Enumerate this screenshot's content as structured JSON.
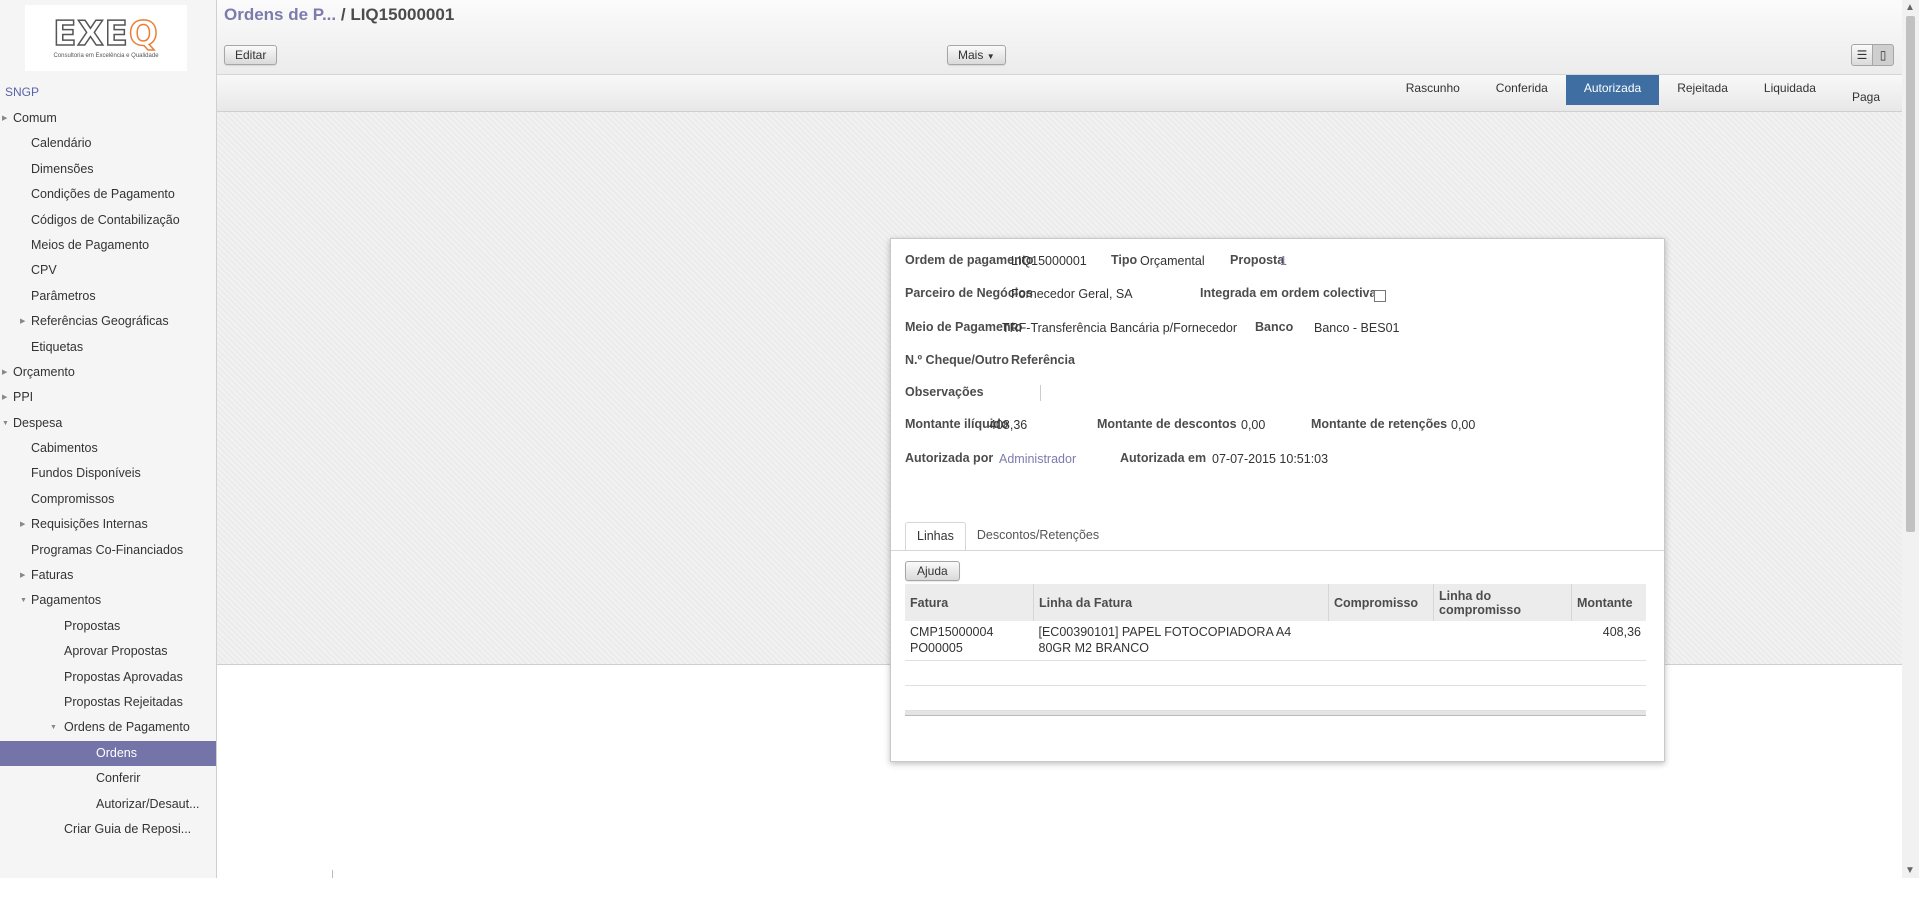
{
  "sidebar": {
    "logo_text": "EXEQ",
    "logo_tagline": "Consultoria em Excelência e Qualidade",
    "app_title": "SNGP",
    "items": [
      {
        "label": "Comum",
        "level": 1,
        "caret": "right"
      },
      {
        "label": "Calendário",
        "level": 2
      },
      {
        "label": "Dimensões",
        "level": 2
      },
      {
        "label": "Condições de Pagamento",
        "level": 2
      },
      {
        "label": "Códigos de Contabilização",
        "level": 2
      },
      {
        "label": "Meios de Pagamento",
        "level": 2
      },
      {
        "label": "CPV",
        "level": 2
      },
      {
        "label": "Parâmetros",
        "level": 2
      },
      {
        "label": "Referências Geográficas",
        "level": 2,
        "caret": "right"
      },
      {
        "label": "Etiquetas",
        "level": 2
      },
      {
        "label": "Orçamento",
        "level": 1,
        "caret": "right"
      },
      {
        "label": "PPI",
        "level": 1,
        "caret": "right"
      },
      {
        "label": "Despesa",
        "level": 1,
        "caret": "down"
      },
      {
        "label": "Cabimentos",
        "level": 2
      },
      {
        "label": "Fundos Disponíveis",
        "level": 2
      },
      {
        "label": "Compromissos",
        "level": 2
      },
      {
        "label": "Requisições Internas",
        "level": 2,
        "caret": "right"
      },
      {
        "label": "Programas Co-Financiados",
        "level": 2
      },
      {
        "label": "Faturas",
        "level": 2,
        "caret": "right"
      },
      {
        "label": "Pagamentos",
        "level": 2,
        "caret": "down"
      },
      {
        "label": "Propostas",
        "level": 3
      },
      {
        "label": "Aprovar Propostas",
        "level": 3
      },
      {
        "label": "Propostas Aprovadas",
        "level": 3
      },
      {
        "label": "Propostas Rejeitadas",
        "level": 3
      },
      {
        "label": "Ordens de Pagamento",
        "level": 3,
        "caret": "down"
      },
      {
        "label": "Ordens",
        "level": 4,
        "selected": true
      },
      {
        "label": "Conferir",
        "level": 4
      },
      {
        "label": "Autorizar/Desaut...",
        "level": 4
      },
      {
        "label": "Criar Guia de Reposi...",
        "level": 3
      }
    ]
  },
  "header": {
    "breadcrumb_parent": "Ordens de P...",
    "breadcrumb_sep": "/",
    "breadcrumb_current": "LIQ15000001",
    "edit_label": "Editar",
    "more_label": "Mais"
  },
  "statusbar": {
    "stages": [
      "Rascunho",
      "Conferida",
      "Autorizada",
      "Rejeitada",
      "Liquidada",
      "Paga"
    ],
    "active_stage": "Autorizada"
  },
  "form": {
    "ordem_label": "Ordem de pagamento",
    "ordem_value": "LIQ15000001",
    "tipo_label": "Tipo",
    "tipo_value": "Orçamental",
    "proposta_label": "Proposta",
    "proposta_value": "1",
    "parceiro_label": "Parceiro de Negócios",
    "parceiro_value": "Fornecedor Geral, SA",
    "integrada_label": "Integrada em ordem colectiva",
    "integrada_checked": false,
    "meio_label": "Meio de Pagamento",
    "meio_value": "TRF-Transferência Bancária p/Fornecedor",
    "banco_label": "Banco",
    "banco_value": "Banco - BES01",
    "cheque_label": "N.º Cheque/Outro",
    "referencia_label": "Referência",
    "observacoes_label": "Observações",
    "liquido_label": "Montante ilíquido",
    "liquido_value": "408,36",
    "descontos_label": "Montante de descontos",
    "descontos_value": "0,00",
    "retencoes_label": "Montante de retenções",
    "retencoes_value": "0,00",
    "autorizada_por_label": "Autorizada por",
    "autorizada_por_value": "Administrador",
    "autorizada_em_label": "Autorizada em",
    "autorizada_em_value": "07-07-2015 10:51:03"
  },
  "tabs": [
    {
      "label": "Linhas",
      "active": true
    },
    {
      "label": "Descontos/Retenções",
      "active": false
    }
  ],
  "lines": {
    "help_label": "Ajuda",
    "columns": [
      "Fatura",
      "Linha da Fatura",
      "Compromisso",
      "Linha do compromisso",
      "Montante"
    ],
    "rows": [
      {
        "fatura": "CMP15000004 PO00005",
        "linha_fatura": "[EC00390101] PAPEL FOTOCOPIADORA A4 80GR M2 BRANCO",
        "compromisso": "",
        "linha_compromisso": "",
        "montante": "408,36"
      }
    ]
  }
}
